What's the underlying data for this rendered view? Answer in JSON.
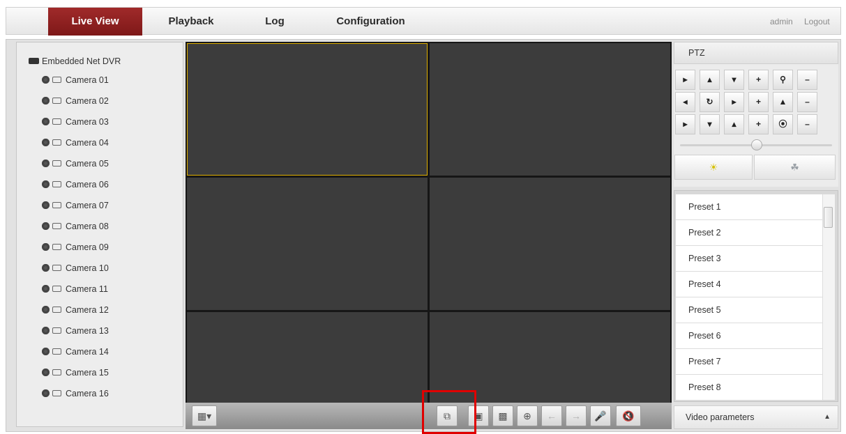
{
  "nav": {
    "tabs": [
      "Live View",
      "Playback",
      "Log",
      "Configuration"
    ],
    "active_tab": "Live View",
    "user": "admin",
    "logout": "Logout"
  },
  "tree": {
    "root": "Embedded Net DVR",
    "cameras": [
      "Camera 01",
      "Camera 02",
      "Camera 03",
      "Camera 04",
      "Camera 05",
      "Camera 06",
      "Camera 07",
      "Camera 08",
      "Camera 09",
      "Camera 10",
      "Camera 11",
      "Camera 12",
      "Camera 13",
      "Camera 14",
      "Camera 15",
      "Camera 16"
    ]
  },
  "ptz": {
    "title": "PTZ",
    "presets": [
      "Preset 1",
      "Preset 2",
      "Preset 3",
      "Preset 4",
      "Preset 5",
      "Preset 6",
      "Preset 7",
      "Preset 8"
    ]
  },
  "video_parameters": "Video parameters",
  "colors": {
    "active_tab": "#8b1f1f",
    "video_cell": "#3c3c3c",
    "selected_outline": "#e0b000",
    "highlight_box": "#e00000"
  }
}
